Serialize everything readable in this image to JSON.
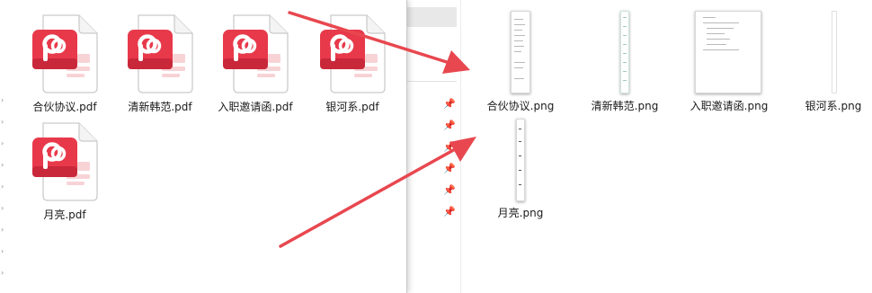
{
  "left_window": {
    "files": [
      {
        "name": "合伙协议.pdf",
        "icon": "pdf-icon"
      },
      {
        "name": "清新韩范.pdf",
        "icon": "pdf-icon"
      },
      {
        "name": "入职邀请函.pdf",
        "icon": "pdf-icon"
      },
      {
        "name": "银河系.pdf",
        "icon": "pdf-icon"
      },
      {
        "name": "月亮.pdf",
        "icon": "pdf-icon"
      }
    ]
  },
  "right_window": {
    "files": [
      {
        "name": "合伙协议.png"
      },
      {
        "name": "清新韩范.png"
      },
      {
        "name": "入职邀请函.png"
      },
      {
        "name": "银河系.png"
      },
      {
        "name": "月亮.png"
      }
    ]
  },
  "colors": {
    "pdf_red": "#e8394b",
    "arrow_red": "#e8474f"
  }
}
